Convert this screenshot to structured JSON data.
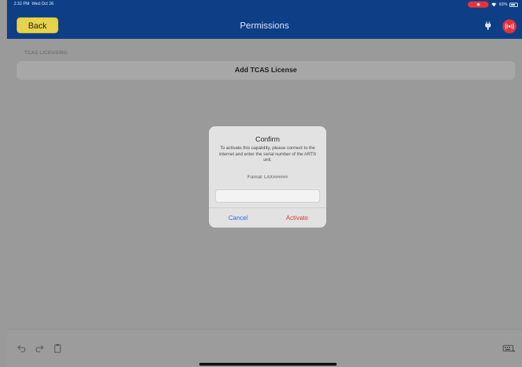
{
  "status_bar": {
    "time": "2:32 PM",
    "date": "Wed Oct 26",
    "record_label": "◉",
    "battery": "63%"
  },
  "nav": {
    "back_label": "Back",
    "title": "Permissions",
    "icons": [
      "plug-icon",
      "broadcast-alarm-icon"
    ]
  },
  "content": {
    "section_header": "TCAS LICENSING",
    "add_row_label": "Add TCAS License"
  },
  "dialog": {
    "title": "Confirm",
    "message": "To activate this capability, please connect to the internet and enter the serial number of the ARTS unit.",
    "format_hint": "Format: LAX######",
    "input_value": "",
    "cancel_label": "Cancel",
    "activate_label": "Activate"
  },
  "toolbar": {
    "icons": [
      "undo-icon",
      "redo-icon",
      "clipboard-icon",
      "keyboard-icon"
    ]
  },
  "colors": {
    "nav_bar": "#0e3f86",
    "back_button": "#e6d34a",
    "alarm": "#e5323b",
    "cancel": "#2f6fd6",
    "activate": "#e23a3a"
  }
}
